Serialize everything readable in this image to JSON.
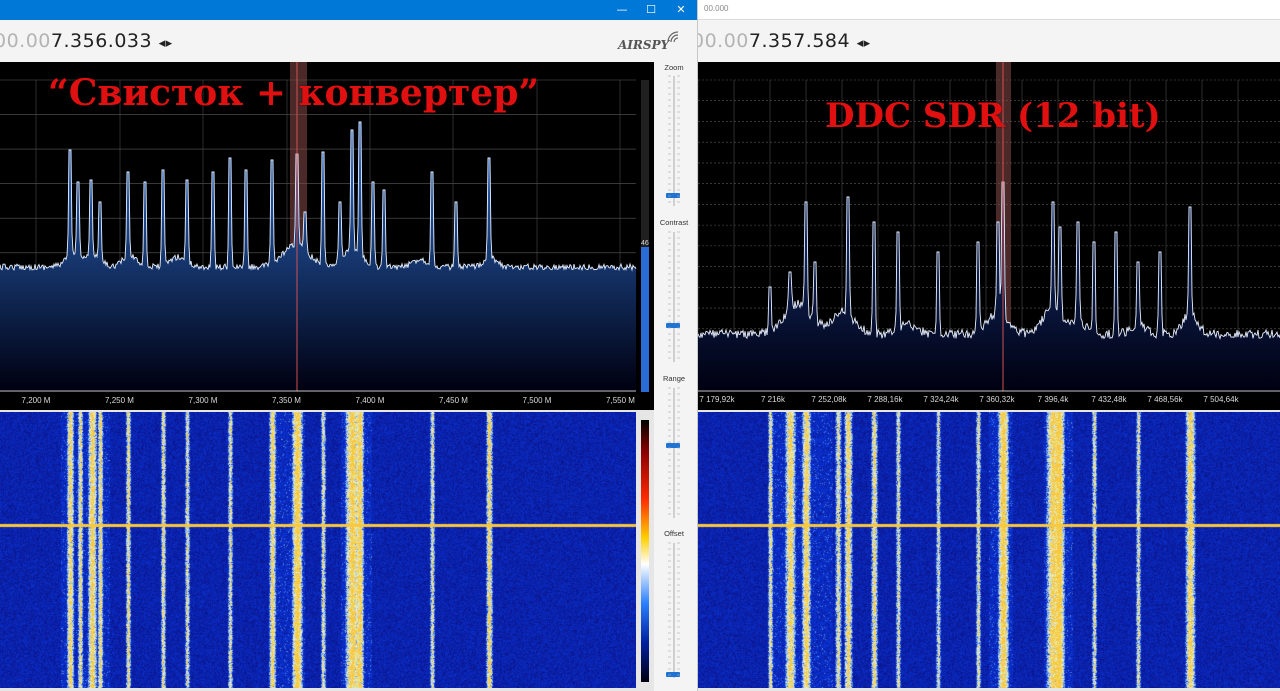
{
  "left_window": {
    "frequency_dim": "00.00",
    "frequency_main": "7.356.033",
    "frequency_arrows": "◂▸",
    "logo": "AIRSPY",
    "title_buttons": {
      "minimize": "—",
      "maximize": "☐",
      "close": "✕"
    },
    "overlay_title": "“Свисток + конвертер”",
    "axis_labels": [
      "7,200 M",
      "7,250 M",
      "7,300 M",
      "7,350 M",
      "7,400 M",
      "7,450 M",
      "7,500 M",
      "7,550 M"
    ],
    "gain_value": "46",
    "side_panel": {
      "zoom_label": "Zoom",
      "contrast_label": "Contrast",
      "range_label": "Range",
      "offset_label": "Offset"
    }
  },
  "right_window": {
    "title_text": "00.000",
    "frequency_dim": "00.00",
    "frequency_main": "7.357.584",
    "frequency_arrows": "◂▸",
    "overlay_title": "DDC SDR (12 bit)",
    "axis_labels": [
      "7 179,92k",
      "7 216k",
      "7 252,08k",
      "7 288,16k",
      "7 324,24k",
      "7 360,32k",
      "7 396,4k",
      "7 432,48k",
      "7 468,56k",
      "7 504,64k"
    ]
  },
  "colors": {
    "titlebar": "#0078d7",
    "overlay_text": "#e01010",
    "slider_thumb": "#1f74d3",
    "spectrum_fill": "#1e5cb4",
    "waterfall_base": "#0a1a9c",
    "filter_band": "#7a4040"
  },
  "icons": [
    "minimize-icon",
    "maximize-icon",
    "close-icon",
    "airspy-logo-icon",
    "tune-arrows-icon"
  ]
}
